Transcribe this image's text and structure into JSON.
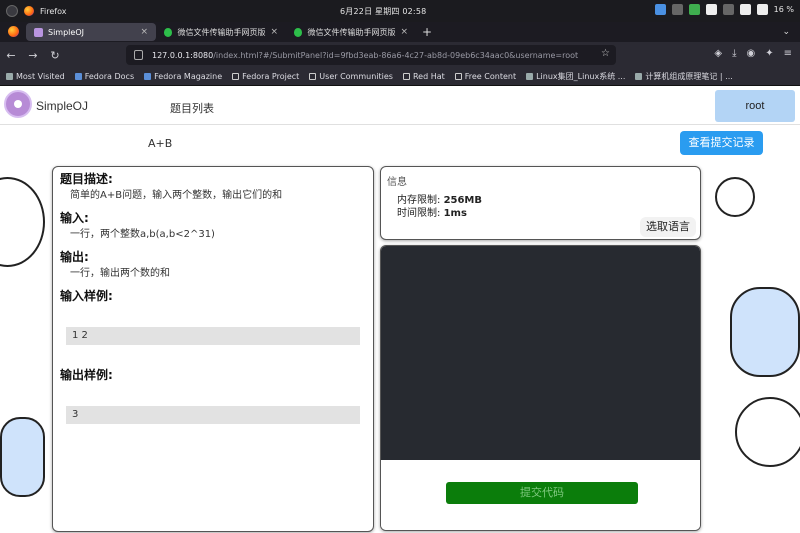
{
  "os": {
    "activity_icon": "os-activities-icon",
    "app_name": "Firefox",
    "clock": "6月22日 星期四  02:58",
    "battery": "16 %"
  },
  "browser": {
    "tabs": [
      {
        "label": "SimpleOJ",
        "active": true
      },
      {
        "label": "微信文件传输助手网页版",
        "active": false
      },
      {
        "label": "微信文件传输助手网页版",
        "active": false
      }
    ],
    "url_host": "127.0.0.1:8080",
    "url_path": "/index.html?#/SubmitPanel?id=9fbd3eab-86a6-4c27-ab8d-09eb6c34aac0&username=root",
    "bookmarks": [
      "Most Visited",
      "Fedora Docs",
      "Fedora Magazine",
      "Fedora Project",
      "User Communities",
      "Red Hat",
      "Free Content",
      "Linux集团_Linux系统 ...",
      "计算机组成原理笔记 | ..."
    ]
  },
  "app": {
    "brand": "SimpleOJ",
    "nav_problems": "题目列表",
    "user": "root",
    "problem_title": "A+B",
    "records_button": "查看提交记录"
  },
  "problem": {
    "desc_h": "题目描述:",
    "desc_t": "简单的A+B问题，输入两个整数，输出它们的和",
    "input_h": "输入:",
    "input_t": "一行，两个整数a,b(a,b<2^31)",
    "output_h": "输出:",
    "output_t": "一行，输出两个数的和",
    "in_sample_h": "输入样例:",
    "in_sample": "1 2",
    "out_sample_h": "输出样例:",
    "out_sample": "3"
  },
  "info": {
    "title": "信息",
    "memory_label": "内存限制:",
    "memory_value": "256MB",
    "time_label": "时间限制:",
    "time_value": "1ms",
    "lang_button": "选取语言"
  },
  "editor": {
    "submit_button": "提交代码"
  }
}
